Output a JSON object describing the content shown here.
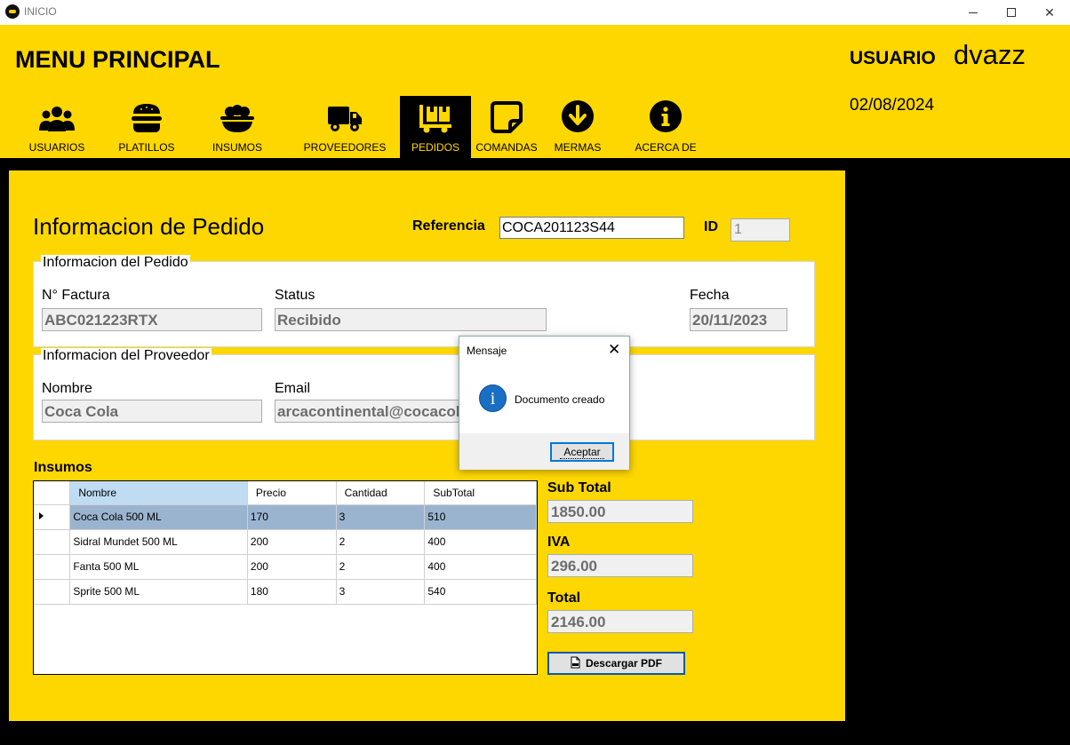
{
  "window": {
    "title": "INICIO"
  },
  "header": {
    "title": "MENU PRINCIPAL",
    "user_label": "USUARIO",
    "user_name": "dvazz",
    "date": "02/08/2024"
  },
  "nav": [
    {
      "label": "USUARIOS",
      "icon": "users-icon"
    },
    {
      "label": "PLATILLOS",
      "icon": "burger-icon"
    },
    {
      "label": "INSUMOS",
      "icon": "bowl-icon"
    },
    {
      "label": "PROVEEDORES",
      "icon": "truck-icon"
    },
    {
      "label": "PEDIDOS",
      "icon": "dolly-icon",
      "active": true
    },
    {
      "label": "COMANDAS",
      "icon": "note-icon"
    },
    {
      "label": "MERMAS",
      "icon": "arrow-down-circle-icon"
    },
    {
      "label": "ACERCA DE",
      "icon": "info-circle-icon"
    }
  ],
  "order": {
    "heading": "Informacion de Pedido",
    "reference_label": "Referencia",
    "reference_value": "COCA201123S44",
    "id_label": "ID",
    "id_value": "1"
  },
  "order_info": {
    "group_title": "Informacion del Pedido",
    "invoice_label": "N° Factura",
    "invoice_value": "ABC021223RTX",
    "status_label": "Status",
    "status_value": "Recibido",
    "date_label": "Fecha",
    "date_value": "20/11/2023"
  },
  "supplier_info": {
    "group_title": "Informacion del Proveedor",
    "name_label": "Nombre",
    "name_value": "Coca Cola",
    "email_label": "Email",
    "email_value": "arcacontinental@cocacola.com"
  },
  "supplies": {
    "title": "Insumos",
    "columns": [
      "Nombre",
      "Precio",
      "Cantidad",
      "SubTotal"
    ],
    "rows": [
      [
        "Coca Cola 500 ML",
        "170",
        "3",
        "510"
      ],
      [
        "Sidral Mundet 500 ML",
        "200",
        "2",
        "400"
      ],
      [
        "Fanta 500 ML",
        "200",
        "2",
        "400"
      ],
      [
        "Sprite 500 ML",
        "180",
        "3",
        "540"
      ]
    ]
  },
  "totals": {
    "subtotal_label": "Sub Total",
    "subtotal_value": "1850.00",
    "iva_label": "IVA",
    "iva_value": "296.00",
    "total_label": "Total",
    "total_value": "2146.00"
  },
  "pdf_button": {
    "label": "Descargar PDF",
    "icon": "pdf-file-icon"
  },
  "dialog": {
    "title": "Mensaje",
    "message": "Documento creado",
    "ok_label": "Aceptar",
    "icon": "info-icon"
  },
  "colors": {
    "brand_yellow": "#ffd700",
    "background": "#000000",
    "selected_row": "#9ab4d0",
    "accent_blue": "#0078d7"
  }
}
